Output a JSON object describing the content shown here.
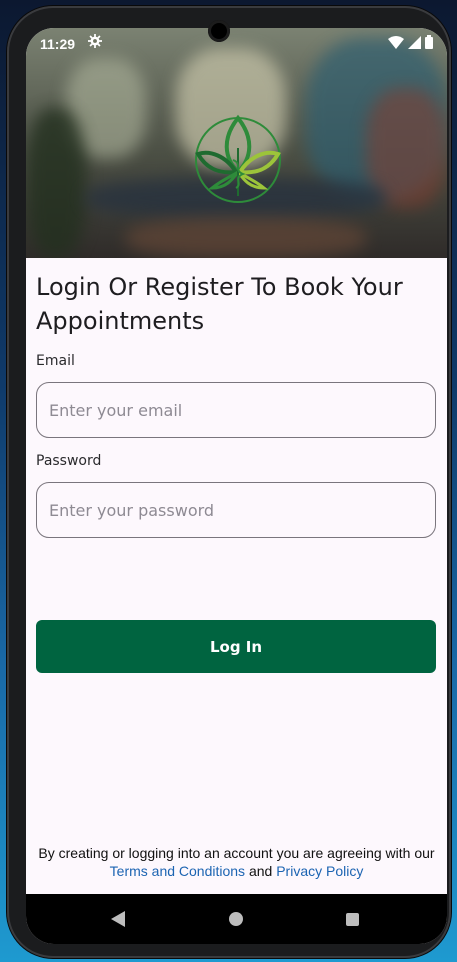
{
  "status_bar": {
    "time": "11:29",
    "icons": [
      "gear-icon",
      "wifi-icon",
      "signal-icon",
      "battery-icon"
    ]
  },
  "header": {
    "title": "Login Or Register To Book Your Appointments"
  },
  "form": {
    "email_label": "Email",
    "email_placeholder": "Enter your email",
    "email_value": "",
    "password_label": "Password",
    "password_placeholder": "Enter your password",
    "password_value": "",
    "submit_label": "Log In"
  },
  "footer": {
    "legal_text": "By creating or logging into an account you are agreeing with our",
    "terms_link": "Terms and Conditions",
    "and_text": "and",
    "privacy_link": "Privacy Policy"
  },
  "nav": {
    "icons": [
      "back-icon",
      "home-icon",
      "recents-icon"
    ]
  },
  "colors": {
    "primary": "#006440",
    "link": "#1c64b2",
    "background": "#fdf8fd",
    "logo_green": "#2e8b3a",
    "logo_lime": "#9cc43a"
  }
}
